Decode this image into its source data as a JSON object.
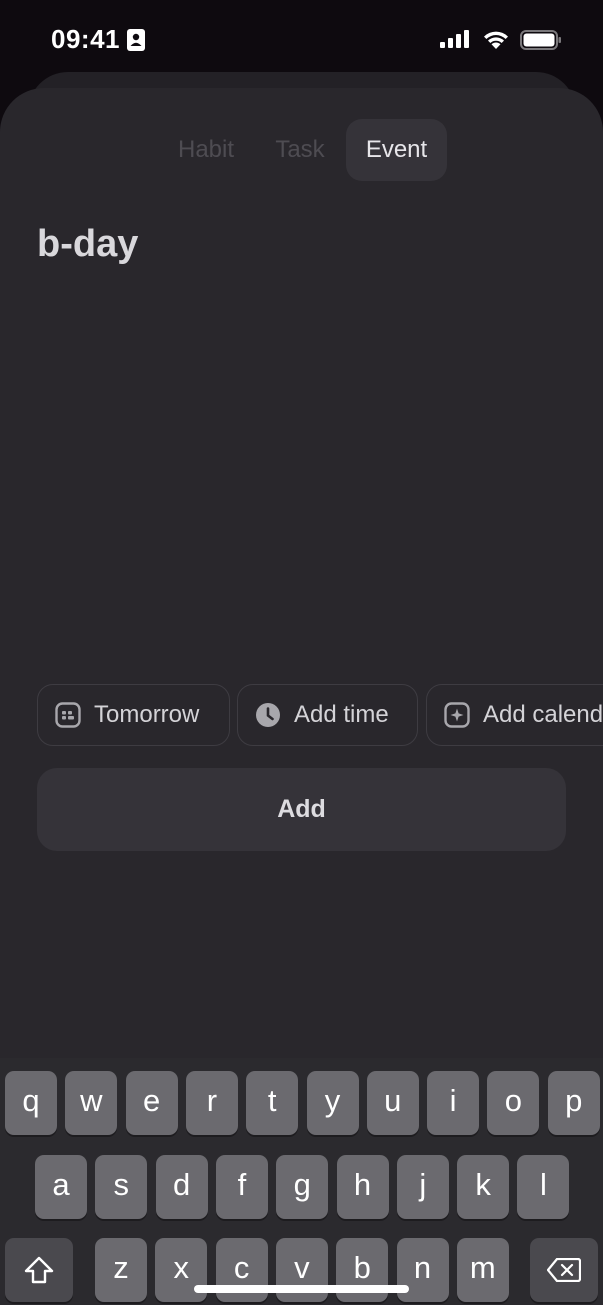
{
  "status_bar": {
    "time": "09:41"
  },
  "segmented": {
    "habit": "Habit",
    "task": "Task",
    "event": "Event",
    "selected": "Event"
  },
  "title_input": {
    "value": "b-day"
  },
  "chips": {
    "date": "Tomorrow",
    "time": "Add time",
    "calendar": "Add calendar"
  },
  "add_button": {
    "label": "Add"
  },
  "keyboard": {
    "row1": [
      "q",
      "w",
      "e",
      "r",
      "t",
      "y",
      "u",
      "i",
      "o",
      "p"
    ],
    "row2": [
      "a",
      "s",
      "d",
      "f",
      "g",
      "h",
      "j",
      "k",
      "l"
    ],
    "row3": [
      "z",
      "x",
      "c",
      "v",
      "b",
      "n",
      "m"
    ]
  },
  "colors": {
    "background": "#0e0a0f",
    "sheet": "#29272c",
    "selected_segment": "#353339",
    "key": "#6b6a6f"
  }
}
